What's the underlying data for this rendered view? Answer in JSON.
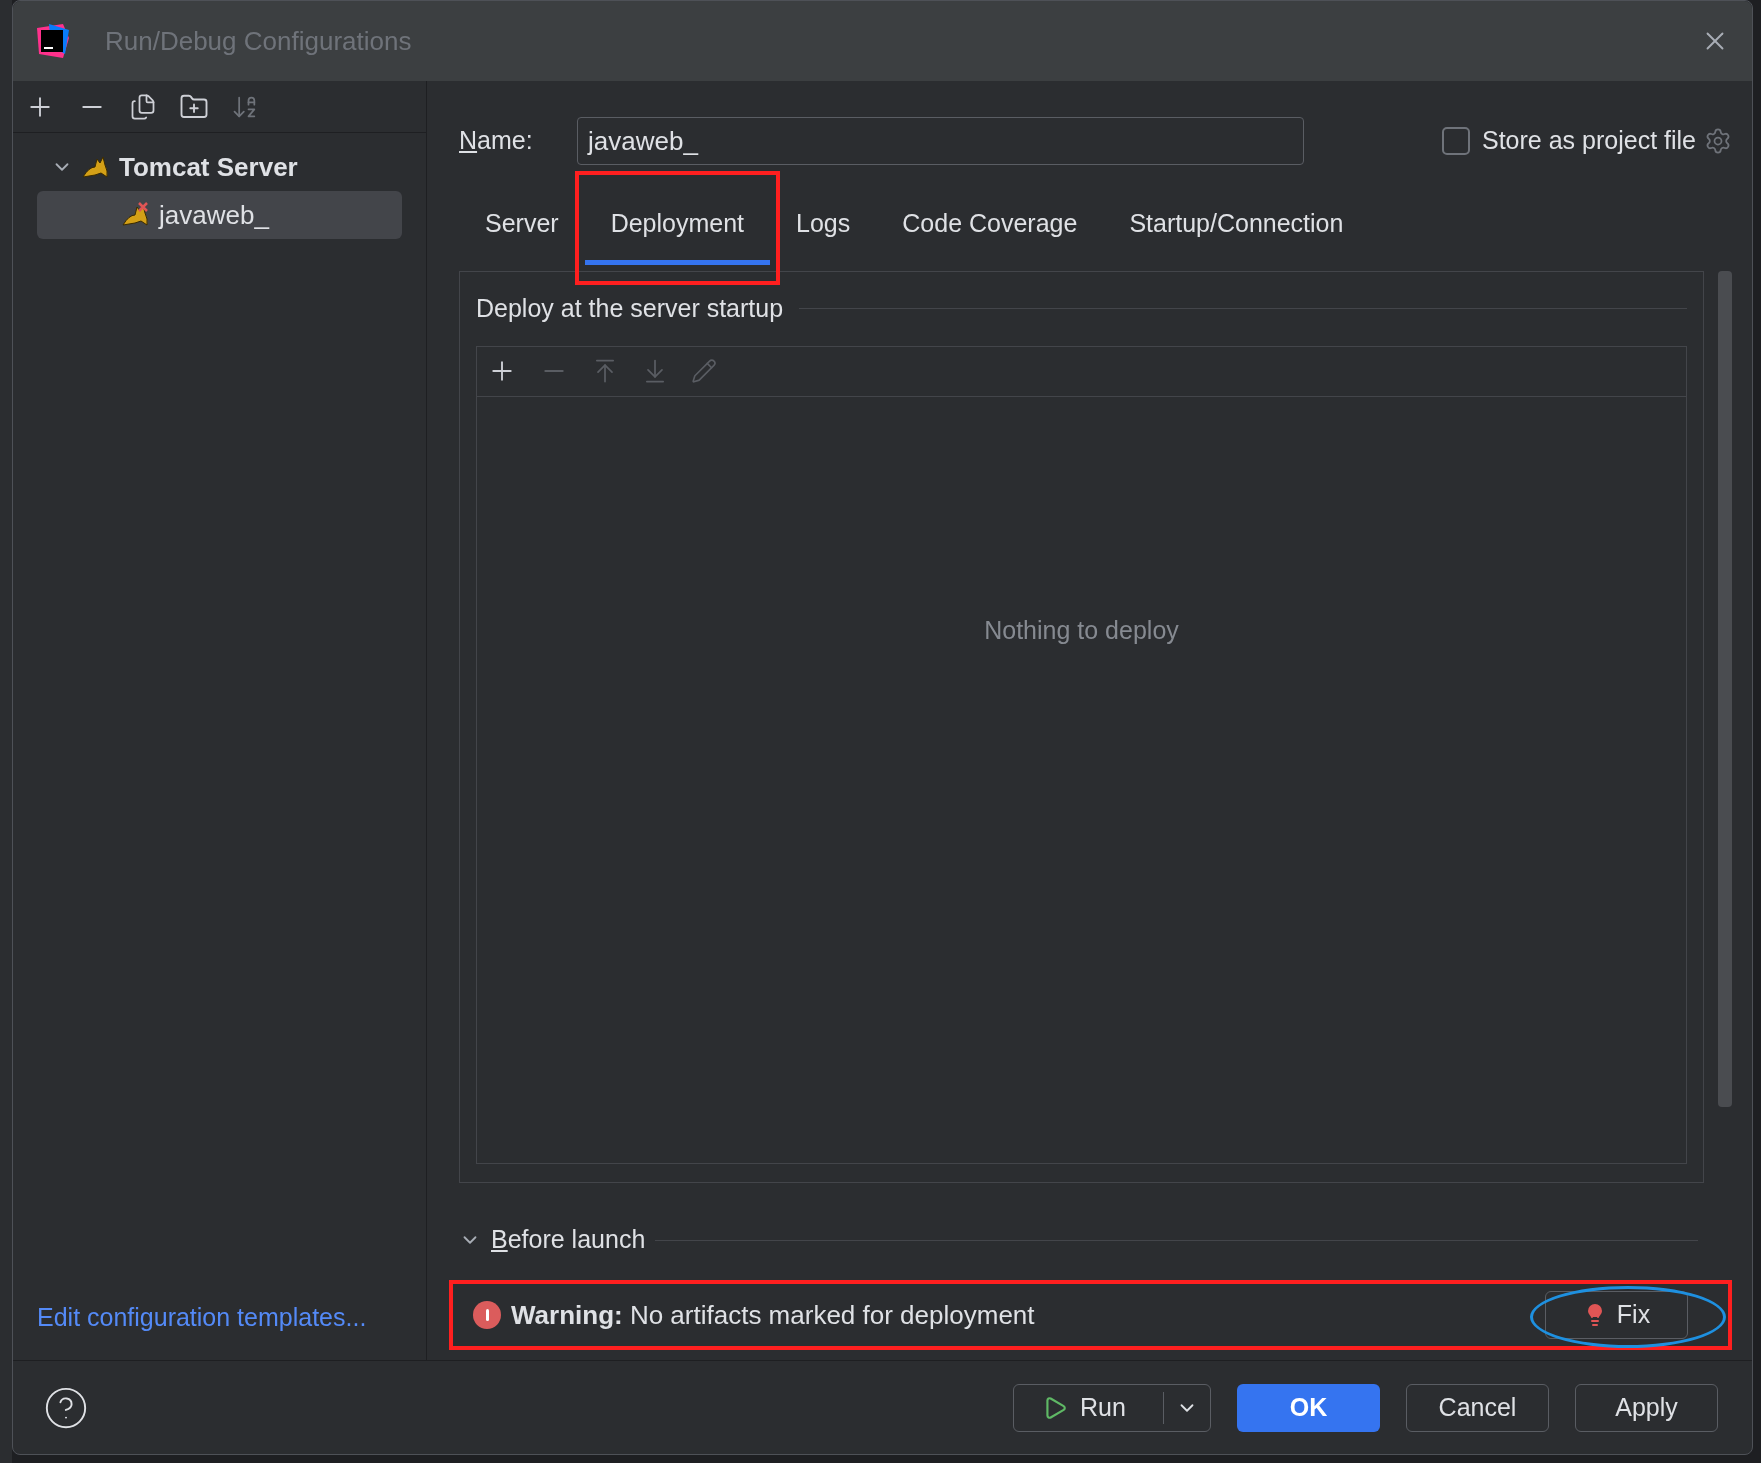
{
  "window": {
    "title": "Run/Debug Configurations"
  },
  "tree": [
    {
      "label": "Tomcat Server",
      "expanded": true,
      "children": [
        {
          "label": "javaweb_",
          "selected": true,
          "error": true
        }
      ]
    }
  ],
  "edit_templates_link": "Edit configuration templates...",
  "name_field": {
    "label": "Name:",
    "value": "javaweb_"
  },
  "store_as_project_file": {
    "label": "Store as project file",
    "checked": false
  },
  "tabs": [
    {
      "label": "Server",
      "selected": false,
      "highlighted": false
    },
    {
      "label": "Deployment",
      "selected": true,
      "highlighted": true
    },
    {
      "label": "Logs",
      "selected": false,
      "highlighted": false
    },
    {
      "label": "Code Coverage",
      "selected": false,
      "highlighted": false
    },
    {
      "label": "Startup/Connection",
      "selected": false,
      "highlighted": false
    }
  ],
  "deploy_section": {
    "title": "Deploy at the server startup",
    "empty_text": "Nothing to deploy"
  },
  "before_launch": {
    "label": "Before launch",
    "expanded": true
  },
  "warning": {
    "message": "**Warning:** No artifacts marked for deployment",
    "highlighted": true,
    "fix_button": {
      "label": "Fix",
      "circled": true
    }
  },
  "buttons": [
    {
      "label": "Run",
      "kind": "split"
    },
    {
      "label": "OK",
      "kind": "primary"
    },
    {
      "label": "Cancel",
      "kind": "plain"
    },
    {
      "label": "Apply",
      "kind": "plain"
    }
  ]
}
